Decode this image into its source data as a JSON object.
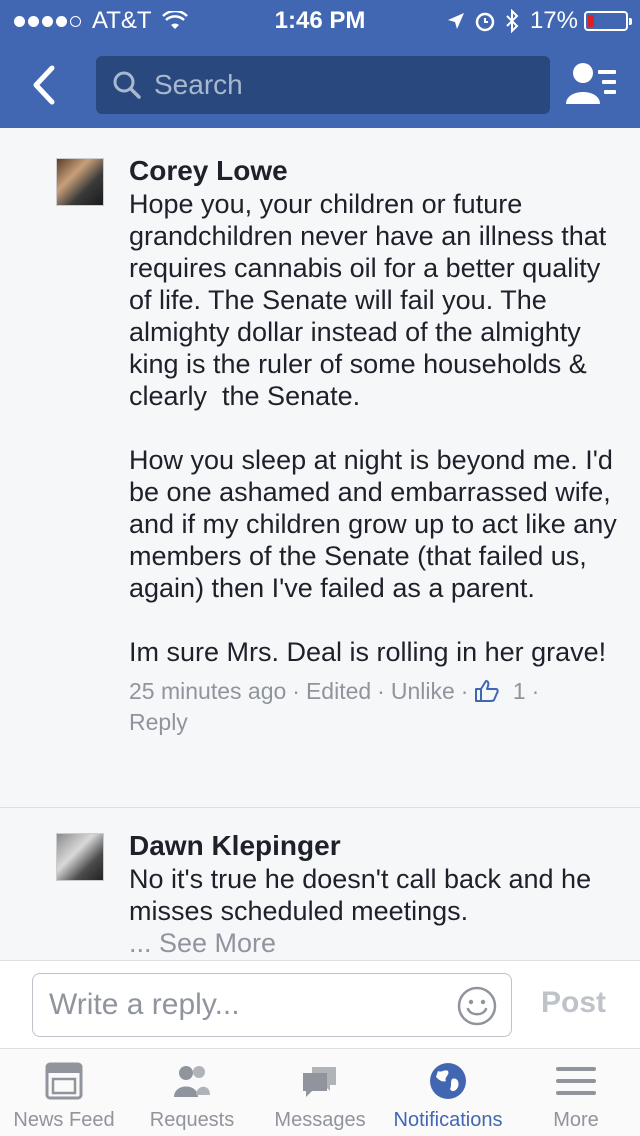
{
  "status_bar": {
    "carrier": "AT&T",
    "time": "1:46 PM",
    "battery": "17%",
    "battery_level": 0.17
  },
  "nav": {
    "search_placeholder": "Search"
  },
  "comments": [
    {
      "author": "Corey Lowe",
      "text": "Hope you, your children or future grandchildren never have an illness that requires cannabis oil for a better quality of life. The Senate will fail you. The almighty dollar instead of the almighty king is the ruler of some households & clearly  the Senate.\n\nHow you sleep at night is beyond me. I'd be one ashamed and embarrassed wife, and if my children grow up to act like any members of the Senate (that failed us, again) then I've failed as a parent.\n\nIm sure Mrs. Deal is rolling in her grave!",
      "time": "25 minutes ago",
      "edited": "Edited",
      "unlike": "Unlike",
      "like_count": "1",
      "reply": "Reply"
    },
    {
      "author": "Dawn Klepinger",
      "text": "No it's true he doesn't call back and he misses scheduled meetings.",
      "see_more": "... See More"
    }
  ],
  "composer": {
    "placeholder": "Write a reply...",
    "post_label": "Post"
  },
  "tabs": [
    {
      "label": "News Feed",
      "icon": "news-feed-icon"
    },
    {
      "label": "Requests",
      "icon": "friend-requests-icon"
    },
    {
      "label": "Messages",
      "icon": "messages-icon"
    },
    {
      "label": "Notifications",
      "icon": "globe-icon",
      "active": true
    },
    {
      "label": "More",
      "icon": "menu-icon"
    }
  ],
  "colors": {
    "brand": "#4267b2",
    "search_bg": "#29487d",
    "muted": "#90949c",
    "battery_low": "#e02020"
  }
}
